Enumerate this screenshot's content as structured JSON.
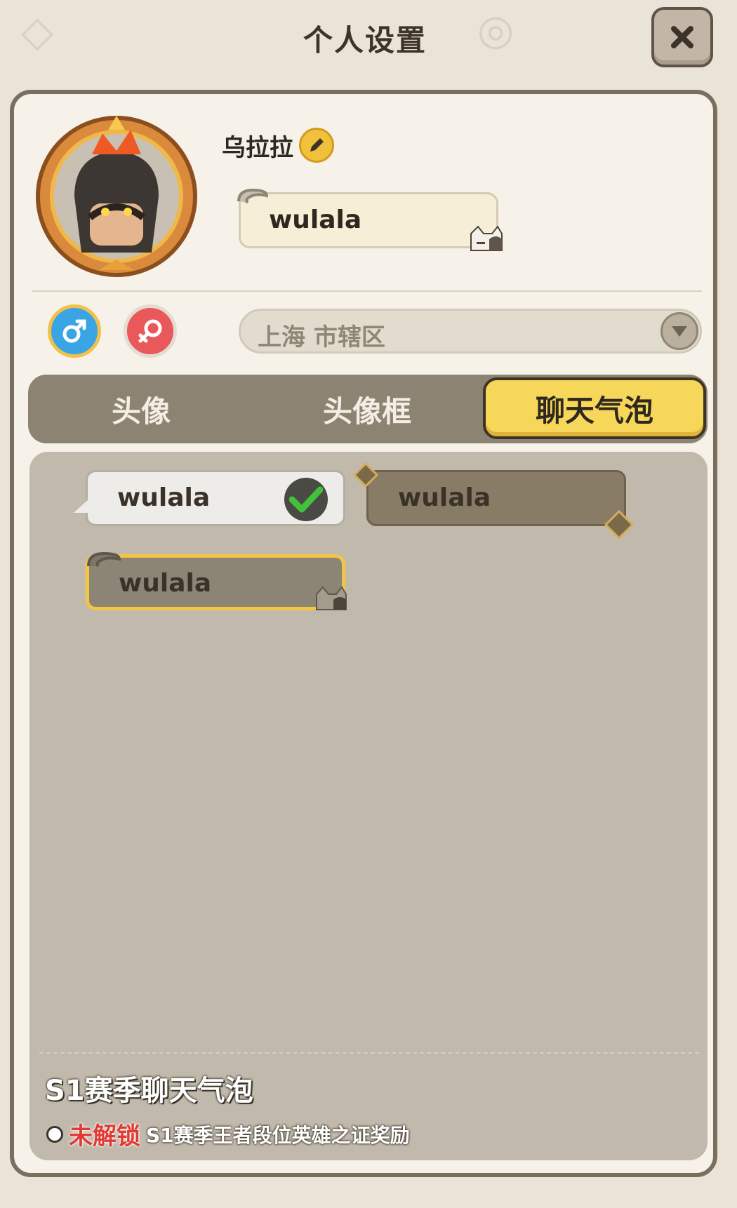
{
  "header": {
    "title": "个人设置",
    "close_icon": "close-icon"
  },
  "profile": {
    "nickname": "乌拉拉",
    "bubble_preview_text": "wulala",
    "gender_male_icon": "male-symbol-icon",
    "gender_female_icon": "female-symbol-icon",
    "selected_gender": "male",
    "region": "上海 市辖区"
  },
  "tabs": [
    {
      "label": "头像",
      "selected": false
    },
    {
      "label": "头像框",
      "selected": false
    },
    {
      "label": "聊天气泡",
      "selected": true
    }
  ],
  "bubbles": [
    {
      "text": "wulala",
      "style": "plain-white",
      "equipped": true
    },
    {
      "text": "wulala",
      "style": "brown-diamond",
      "equipped": false
    },
    {
      "text": "wulala",
      "style": "grey-cat",
      "equipped": false,
      "selected": true
    }
  ],
  "detail": {
    "name": "S1赛季聊天气泡",
    "status": "未解锁",
    "requirement": "S1赛季王者段位英雄之证奖励"
  },
  "colors": {
    "accent": "#f7d75a",
    "locked": "#e13a33",
    "panel": "#f6f2ea"
  }
}
